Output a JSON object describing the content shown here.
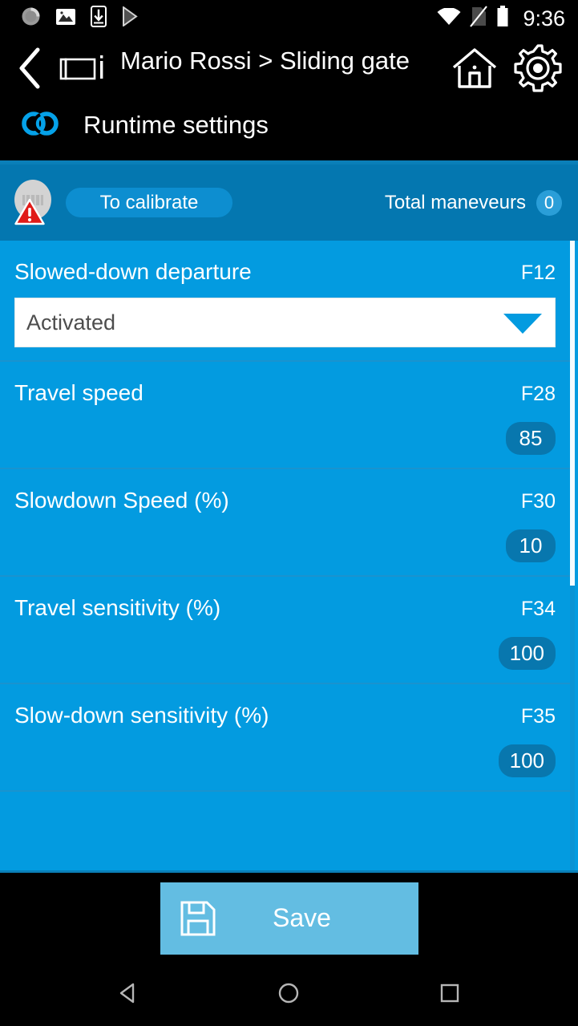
{
  "statusbar": {
    "time": "9:36",
    "left_icons": [
      {
        "name": "sync-spinner-icon"
      },
      {
        "name": "photo-icon"
      },
      {
        "name": "app-install-icon"
      },
      {
        "name": "play-store-icon"
      }
    ],
    "right_icons": [
      {
        "name": "wifi-icon"
      },
      {
        "name": "no-sim-icon"
      },
      {
        "name": "battery-icon"
      }
    ]
  },
  "header": {
    "back_icon": "back-chevron-icon",
    "device_icon": "sliding-gate-icon",
    "title": "Mario Rossi > Sliding gate",
    "home_icon": "home-icon",
    "gear_icon": "gear-icon",
    "link_icon": "linked-rings-icon",
    "subtitle": "Runtime settings"
  },
  "device_status": {
    "device_icon": "gate-status-icon",
    "warning_icon": "warning-triangle-icon",
    "calibrate_label": "To calibrate",
    "maneuvers_label": "Total maneveurs",
    "maneuvers_count": "0"
  },
  "settings": {
    "rows": [
      {
        "label": "Slowed-down departure",
        "code": "F12",
        "type": "dropdown",
        "value": "Activated",
        "arrow_icon": "chevron-down-icon"
      },
      {
        "label": "Travel speed",
        "code": "F28",
        "type": "value",
        "value": "85"
      },
      {
        "label": "Slowdown Speed (%)",
        "code": "F30",
        "type": "value",
        "value": "10"
      },
      {
        "label": "Travel sensitivity (%)",
        "code": "F34",
        "type": "value",
        "value": "100"
      },
      {
        "label": "Slow-down sensitivity (%)",
        "code": "F35",
        "type": "value",
        "value": "100"
      }
    ]
  },
  "footer": {
    "save_label": "Save",
    "save_icon": "floppy-disk-icon"
  },
  "navbar": {
    "back_icon": "nav-back-icon",
    "home_icon": "nav-home-icon",
    "recents_icon": "nav-recents-icon"
  },
  "colors": {
    "status_strip": "#0477b0",
    "list_background": "#039be0",
    "badge": "#0877ae",
    "pill": "#0d8ed0",
    "save_button": "#63bde2",
    "warning": "#e01b18",
    "accent": "#0a7fb8"
  }
}
